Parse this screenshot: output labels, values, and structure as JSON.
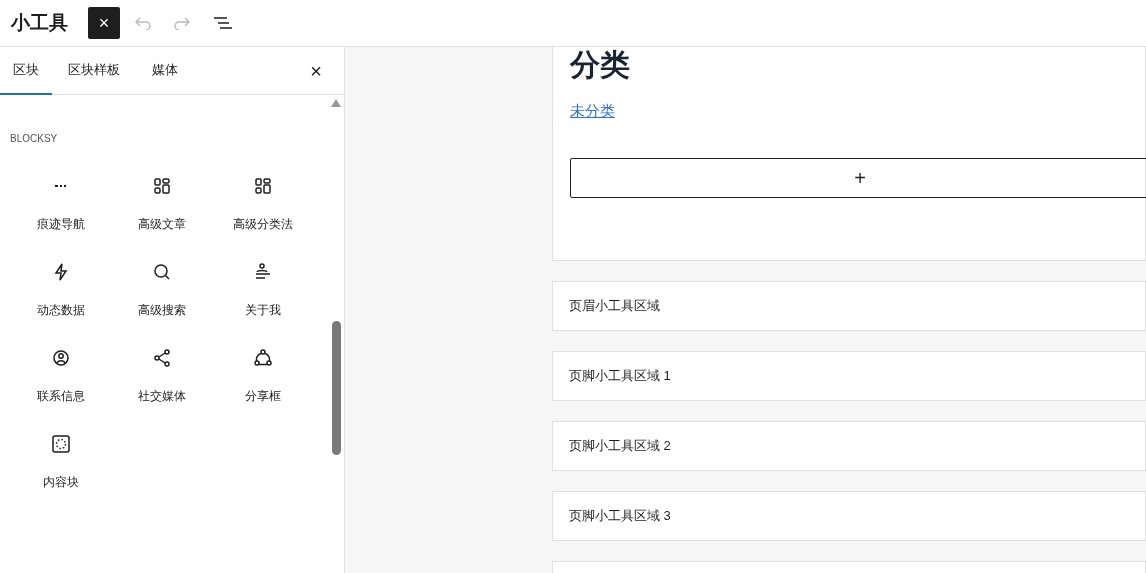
{
  "header": {
    "title": "小工具",
    "close_symbol": "×"
  },
  "inserter": {
    "tabs": [
      {
        "label": "区块",
        "selected": true
      },
      {
        "label": "区块样板",
        "selected": false
      },
      {
        "label": "媒体",
        "selected": false
      }
    ],
    "close_symbol": "×",
    "category": "BLOCKSY",
    "blocks": [
      {
        "label": "痕迹导航"
      },
      {
        "label": "高级文章"
      },
      {
        "label": "高级分类法"
      },
      {
        "label": "动态数据"
      },
      {
        "label": "高级搜索"
      },
      {
        "label": "关于我"
      },
      {
        "label": "联系信息"
      },
      {
        "label": "社交媒体"
      },
      {
        "label": "分享框"
      },
      {
        "label": "内容块"
      }
    ]
  },
  "canvas": {
    "heading": "分类",
    "link": "未分类",
    "add_symbol": "+",
    "widget_areas": [
      {
        "title": "页眉小工具区域"
      },
      {
        "title": "页脚小工具区域 1"
      },
      {
        "title": "页脚小工具区域 2"
      },
      {
        "title": "页脚小工具区域 3"
      }
    ]
  }
}
